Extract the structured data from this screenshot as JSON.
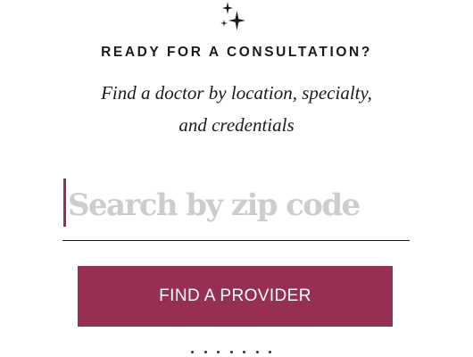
{
  "icons": {
    "sparkle": "sparkle-icon"
  },
  "colors": {
    "accent": "#962f52",
    "text": "#1b1b1b",
    "placeholder": "#cdcdcd"
  },
  "hero": {
    "heading": "READY FOR A CONSULTATION?",
    "subtitle_line1": "Find a doctor by location, specialty,",
    "subtitle_line2": "and credentials"
  },
  "search": {
    "value": "",
    "placeholder": "Search by zip code"
  },
  "cta": {
    "label": "FIND A PROVIDER"
  },
  "pager": {
    "dot_count": 7
  }
}
